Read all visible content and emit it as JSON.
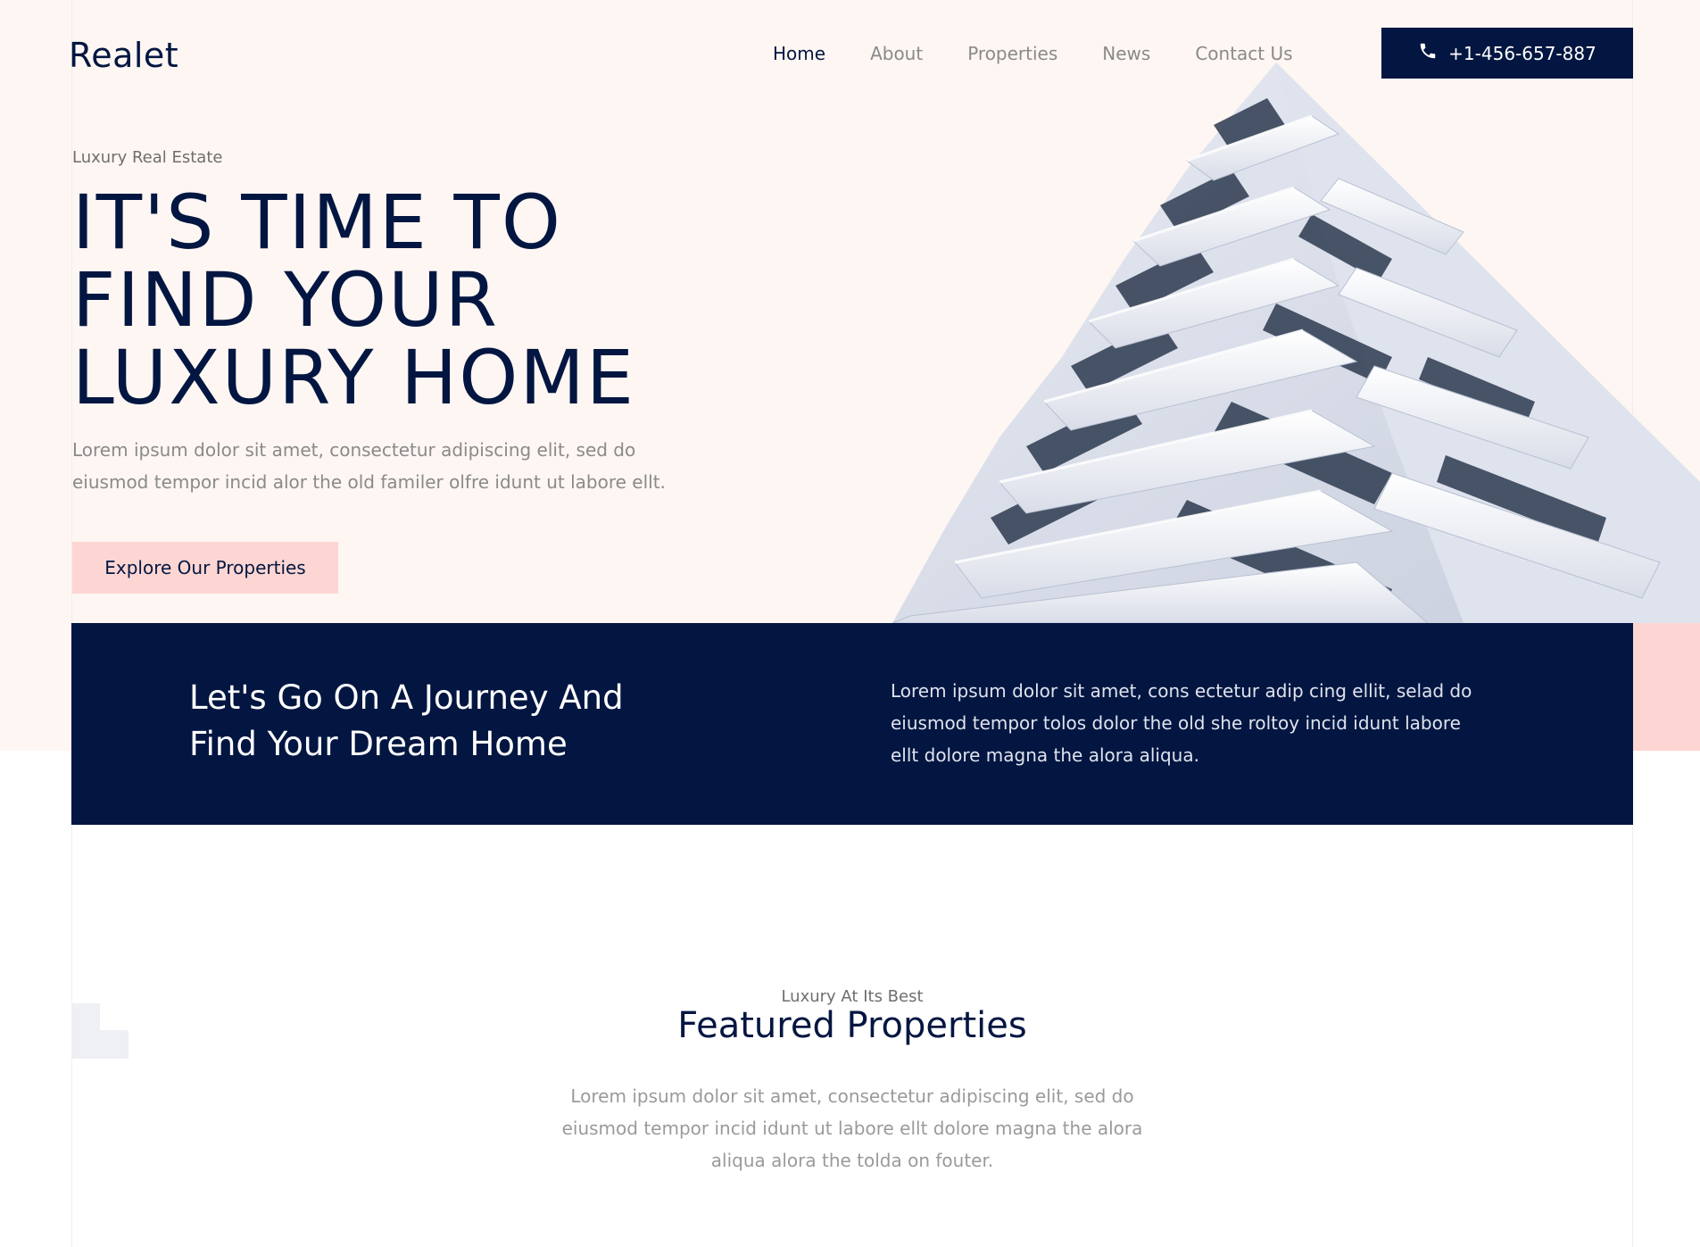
{
  "brand": {
    "logo": "Realet"
  },
  "nav": {
    "items": [
      {
        "label": "Home",
        "active": true
      },
      {
        "label": "About",
        "active": false
      },
      {
        "label": "Properties",
        "active": false
      },
      {
        "label": "News",
        "active": false
      },
      {
        "label": "Contact Us",
        "active": false
      }
    ],
    "phone": {
      "label": "+1-456-657-887",
      "icon": "phone-icon"
    }
  },
  "hero": {
    "eyebrow": "Luxury Real Estate",
    "title_lines": [
      "IT'S TIME TO",
      "FIND YOUR",
      "LUXURY HOME"
    ],
    "text": "Lorem ipsum dolor sit amet, consectetur adipiscing elit, sed do eiusmod tempor incid alor the old familer olfre idunt ut labore ellt.",
    "cta_label": "Explore Our Properties",
    "image": "building-facade-image"
  },
  "band": {
    "title": "Let's Go On A Journey And Find Your Dream Home",
    "text": "Lorem ipsum dolor sit amet, cons ectetur adip cing ellit, selad do eiusmod tempor tolos dolor the old she roltoy incid idunt labore ellt dolore magna the alora aliqua."
  },
  "featured": {
    "eyebrow": "Luxury At Its Best",
    "title": "Featured Properties",
    "text": "Lorem ipsum dolor sit amet, consectetur adipiscing elit, sed do eiusmod tempor incid idunt ut labore ellt dolore magna the alora aliqua alora the tolda on fouter."
  },
  "colors": {
    "navy": "#031641",
    "cream": "#fdf6f2",
    "pink": "#fdd6d3",
    "muted_text": "#8a8a8a"
  }
}
